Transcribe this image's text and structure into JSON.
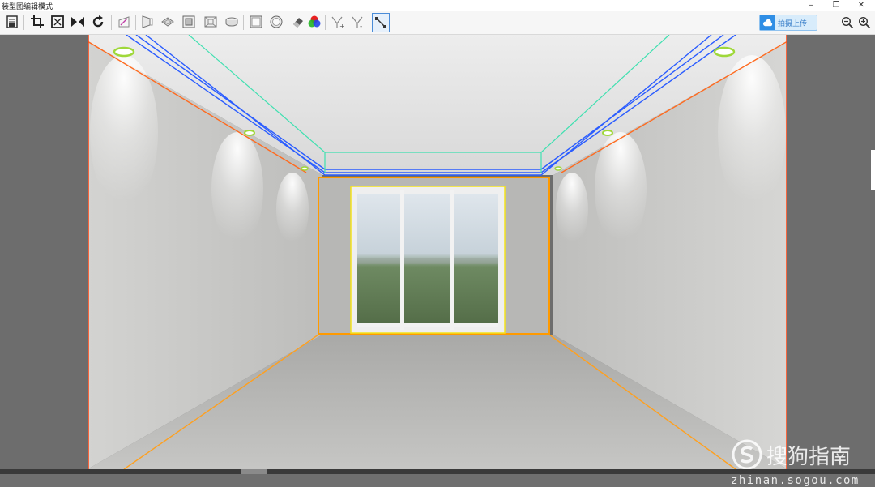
{
  "window": {
    "title": "装型图编辑模式",
    "minimize": "–",
    "restore": "❐",
    "close": "✕"
  },
  "toolbar": {
    "tools": [
      {
        "name": "save-tool-icon"
      },
      {
        "name": "crop-tool-icon"
      },
      {
        "name": "fit-tool-icon"
      },
      {
        "name": "flip-tool-icon"
      },
      {
        "name": "rotate-tool-icon"
      },
      {
        "name": "perspective-tool-icon"
      },
      {
        "name": "wall-tool-icon"
      },
      {
        "name": "floor-tool-icon"
      },
      {
        "name": "frame-tool-icon"
      },
      {
        "name": "room-tool-icon"
      },
      {
        "name": "ellipse-tool-icon"
      },
      {
        "name": "square-tool-icon"
      },
      {
        "name": "circle-tool-icon"
      },
      {
        "name": "eraser-tool-icon"
      },
      {
        "name": "color-tool-icon"
      },
      {
        "name": "add-point-tool-icon"
      },
      {
        "name": "remove-point-tool-icon"
      },
      {
        "name": "line-tool-icon"
      }
    ],
    "upload_label": "拍摄上传",
    "zoom_out": "zoom-out-icon",
    "zoom_in": "zoom-in-icon"
  },
  "colors": {
    "ceiling_green": "#3fe0b0",
    "ceiling_blue": "#2a5cff",
    "wall_edge_orange": "#ff6a1e",
    "floor_edge_orange": "#ffa01e",
    "back_wall_orange": "#ff9a00",
    "window_yellow": "#f3e21c",
    "light_ring": "#9fd83a"
  },
  "watermark": {
    "brand": "搜狗指南",
    "url": "zhinan.sogou.com"
  }
}
